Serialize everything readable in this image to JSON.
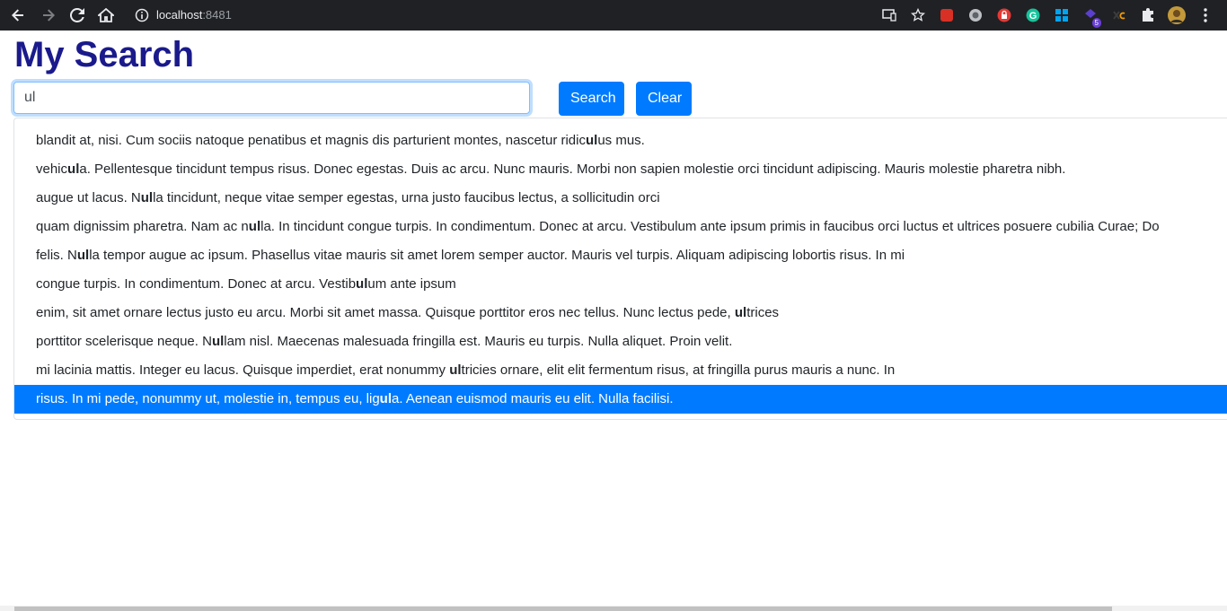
{
  "browser": {
    "url_host": "localhost",
    "url_port": ":8481",
    "extension_badge": "5"
  },
  "page": {
    "title": "My Search"
  },
  "search": {
    "value": "ul",
    "search_label": "Search",
    "clear_label": "Clear"
  },
  "suggestions": [
    {
      "pre": "blandit at, nisi. Cum sociis natoque penatibus et magnis dis parturient montes, nascetur ridic",
      "match": "ul",
      "post": "us mus."
    },
    {
      "pre": "vehic",
      "match": "ul",
      "post": "a. Pellentesque tincidunt tempus risus. Donec egestas. Duis ac arcu. Nunc mauris. Morbi non sapien molestie orci tincidunt adipiscing. Mauris molestie pharetra nibh."
    },
    {
      "pre": "augue ut lacus. N",
      "match": "ul",
      "post": "la tincidunt, neque vitae semper egestas, urna justo faucibus lectus, a sollicitudin orci"
    },
    {
      "pre": "quam dignissim pharetra. Nam ac n",
      "match": "ul",
      "post": "la. In tincidunt congue turpis. In condimentum. Donec at arcu. Vestibulum ante ipsum primis in faucibus orci luctus et ultrices posuere cubilia Curae; Do"
    },
    {
      "pre": "felis. N",
      "match": "ul",
      "post": "la tempor augue ac ipsum. Phasellus vitae mauris sit amet lorem semper auctor. Mauris vel turpis. Aliquam adipiscing lobortis risus. In mi"
    },
    {
      "pre": "congue turpis. In condimentum. Donec at arcu. Vestib",
      "match": "ul",
      "post": "um ante ipsum"
    },
    {
      "pre": "enim, sit amet ornare lectus justo eu arcu. Morbi sit amet massa. Quisque porttitor eros nec tellus. Nunc lectus pede, ",
      "match": "ul",
      "post": "trices"
    },
    {
      "pre": "porttitor scelerisque neque. N",
      "match": "ul",
      "post": "lam nisl. Maecenas malesuada fringilla est. Mauris eu turpis. Nulla aliquet. Proin velit."
    },
    {
      "pre": "mi lacinia mattis. Integer eu lacus. Quisque imperdiet, erat nonummy ",
      "match": "ul",
      "post": "tricies ornare, elit elit fermentum risus, at fringilla purus mauris a nunc. In"
    },
    {
      "pre": "risus. In mi pede, nonummy ut, molestie in, tempus eu, lig",
      "match": "ul",
      "post": "a. Aenean euismod mauris eu elit. Nulla facilisi.",
      "active": true
    }
  ],
  "colors": {
    "accent": "#007bff",
    "title": "#1a1a8c"
  }
}
